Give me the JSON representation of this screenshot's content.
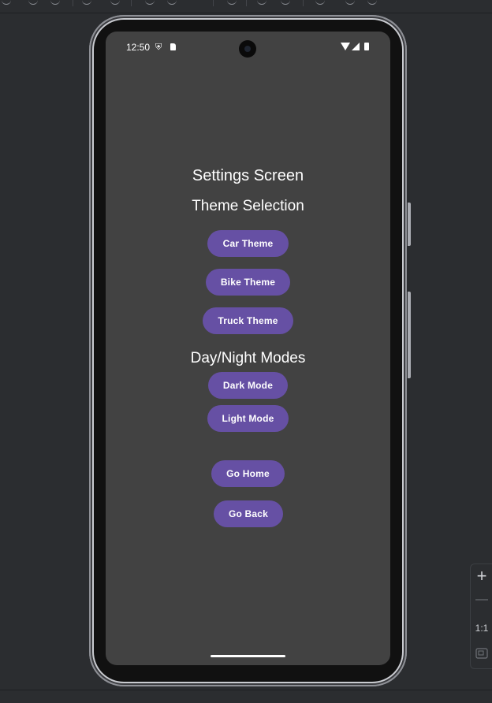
{
  "status_bar": {
    "time": "12:50"
  },
  "screen": {
    "title": "Settings Screen",
    "theme_section_title": "Theme Selection",
    "theme_buttons": [
      "Car Theme",
      "Bike Theme",
      "Truck Theme"
    ],
    "mode_section_title": "Day/Night Modes",
    "mode_buttons": [
      "Dark Mode",
      "Light Mode"
    ],
    "nav_buttons": [
      "Go Home",
      "Go Back"
    ]
  },
  "zoom_controls": {
    "zoom_in": "+",
    "zoom_out": "—",
    "actual_size": "1:1"
  },
  "colors": {
    "button": "#6650a4",
    "screen_background": "#424242",
    "ide_background": "#2b2d30"
  }
}
